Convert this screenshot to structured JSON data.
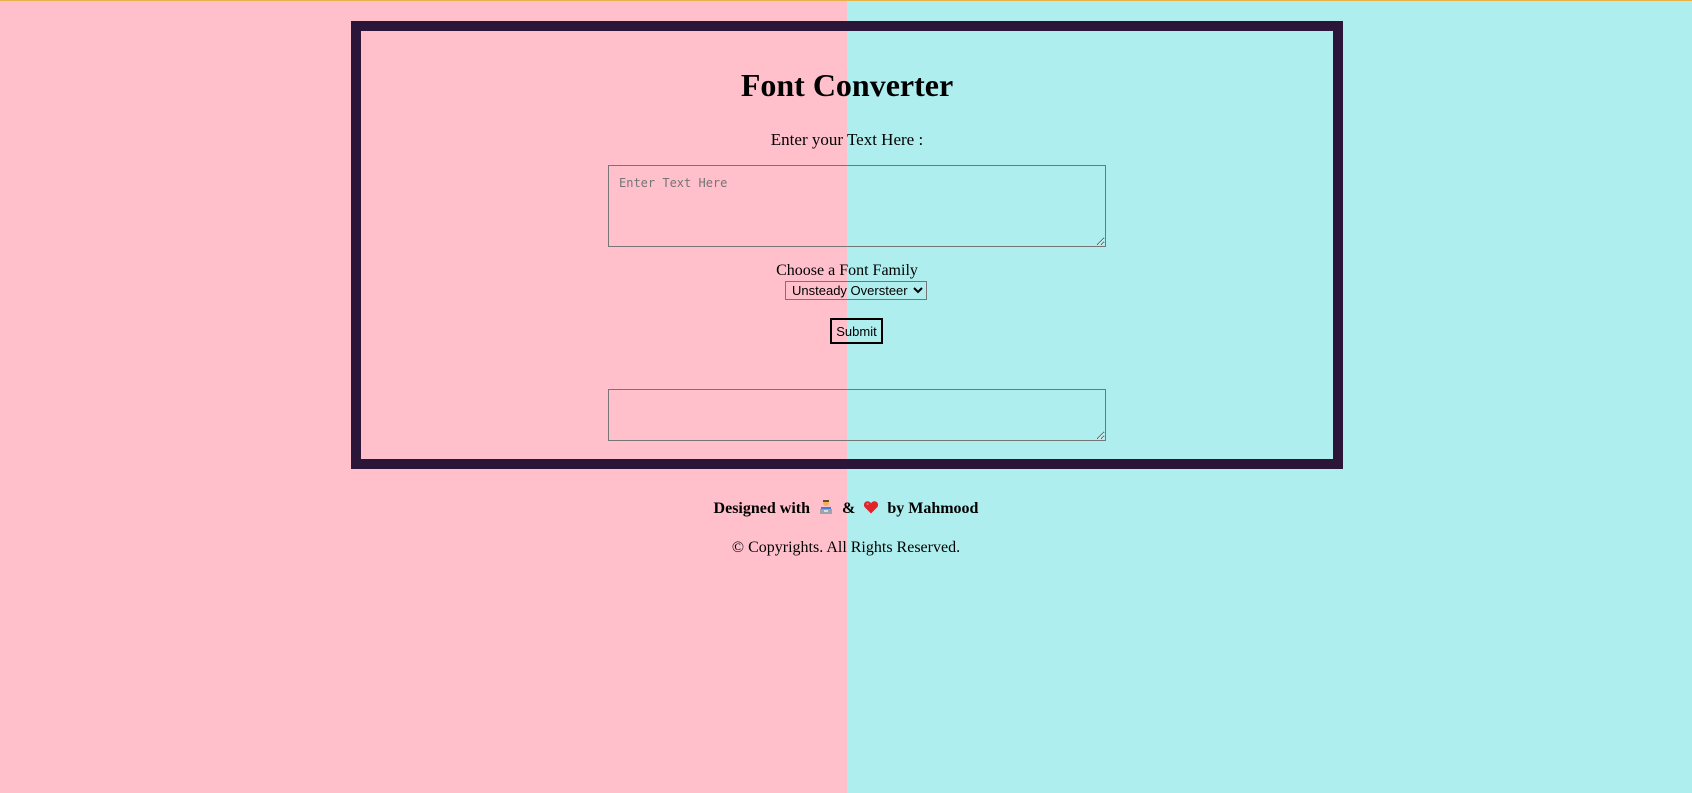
{
  "page": {
    "background_left": "#ffc0cb",
    "background_right": "#afeeee",
    "card_border_color": "#2b1639"
  },
  "converter": {
    "title": "Font Converter",
    "prompt_label": "Enter your Text Here :",
    "input_placeholder": "Enter Text Here",
    "font_family_label": "Choose a Font Family",
    "font_family_selected": "Unsteady Oversteer",
    "submit_label": "Submit",
    "output_value": ""
  },
  "footer": {
    "designed_with": "Designed with",
    "ampersand": "&",
    "by_author": "by Mahmood",
    "icons": [
      "technologist-icon",
      "red-heart-icon"
    ],
    "copyright": "© Copyrights. All Rights Reserved."
  }
}
